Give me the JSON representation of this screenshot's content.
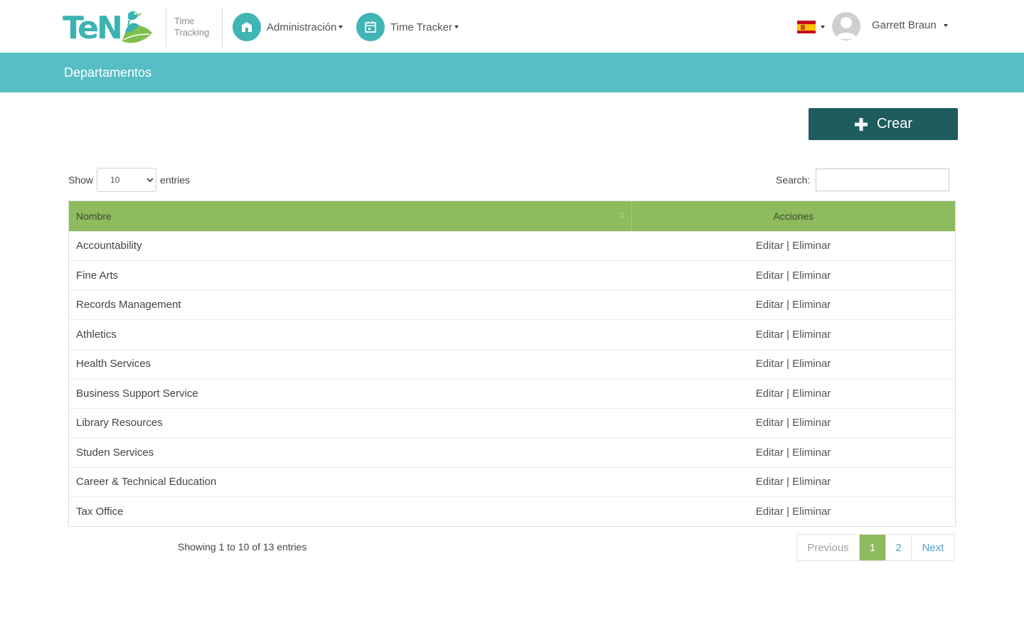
{
  "brand": {
    "logo_text": "TeN",
    "subtitle_line1": "Time",
    "subtitle_line2": "Tracking"
  },
  "nav": {
    "admin_label": "Administración",
    "tracker_label": "Time Tracker"
  },
  "user": {
    "language_flag": "es-flag-icon",
    "name": "Garrett Braun"
  },
  "page": {
    "title": "Departamentos"
  },
  "toolbar": {
    "create_label": "Crear"
  },
  "controls": {
    "show_label": "Show",
    "entries_label": "entries",
    "length_selected": "10",
    "search_label": "Search:",
    "search_value": ""
  },
  "table": {
    "headers": {
      "name": "Nombre",
      "actions": "Acciones"
    },
    "edit_label": "Editar",
    "delete_label": "Eliminar",
    "separator": "|",
    "rows": [
      {
        "name": "Accountability"
      },
      {
        "name": "Fine Arts"
      },
      {
        "name": "Records Management"
      },
      {
        "name": "Athletics"
      },
      {
        "name": "Health Services"
      },
      {
        "name": "Business Support Service"
      },
      {
        "name": "Library Resources"
      },
      {
        "name": "Studen Services"
      },
      {
        "name": "Career & Technical Education"
      },
      {
        "name": "Tax Office"
      }
    ]
  },
  "footer": {
    "info": "Showing 1 to 10 of 13 entries",
    "prev_label": "Previous",
    "page_1": "1",
    "page_2": "2",
    "next_label": "Next"
  },
  "colors": {
    "accent": "#56bec4",
    "header_green": "#8dbb5d",
    "create_button": "#1e5c5d",
    "nav_icon": "#3fb5b5"
  }
}
